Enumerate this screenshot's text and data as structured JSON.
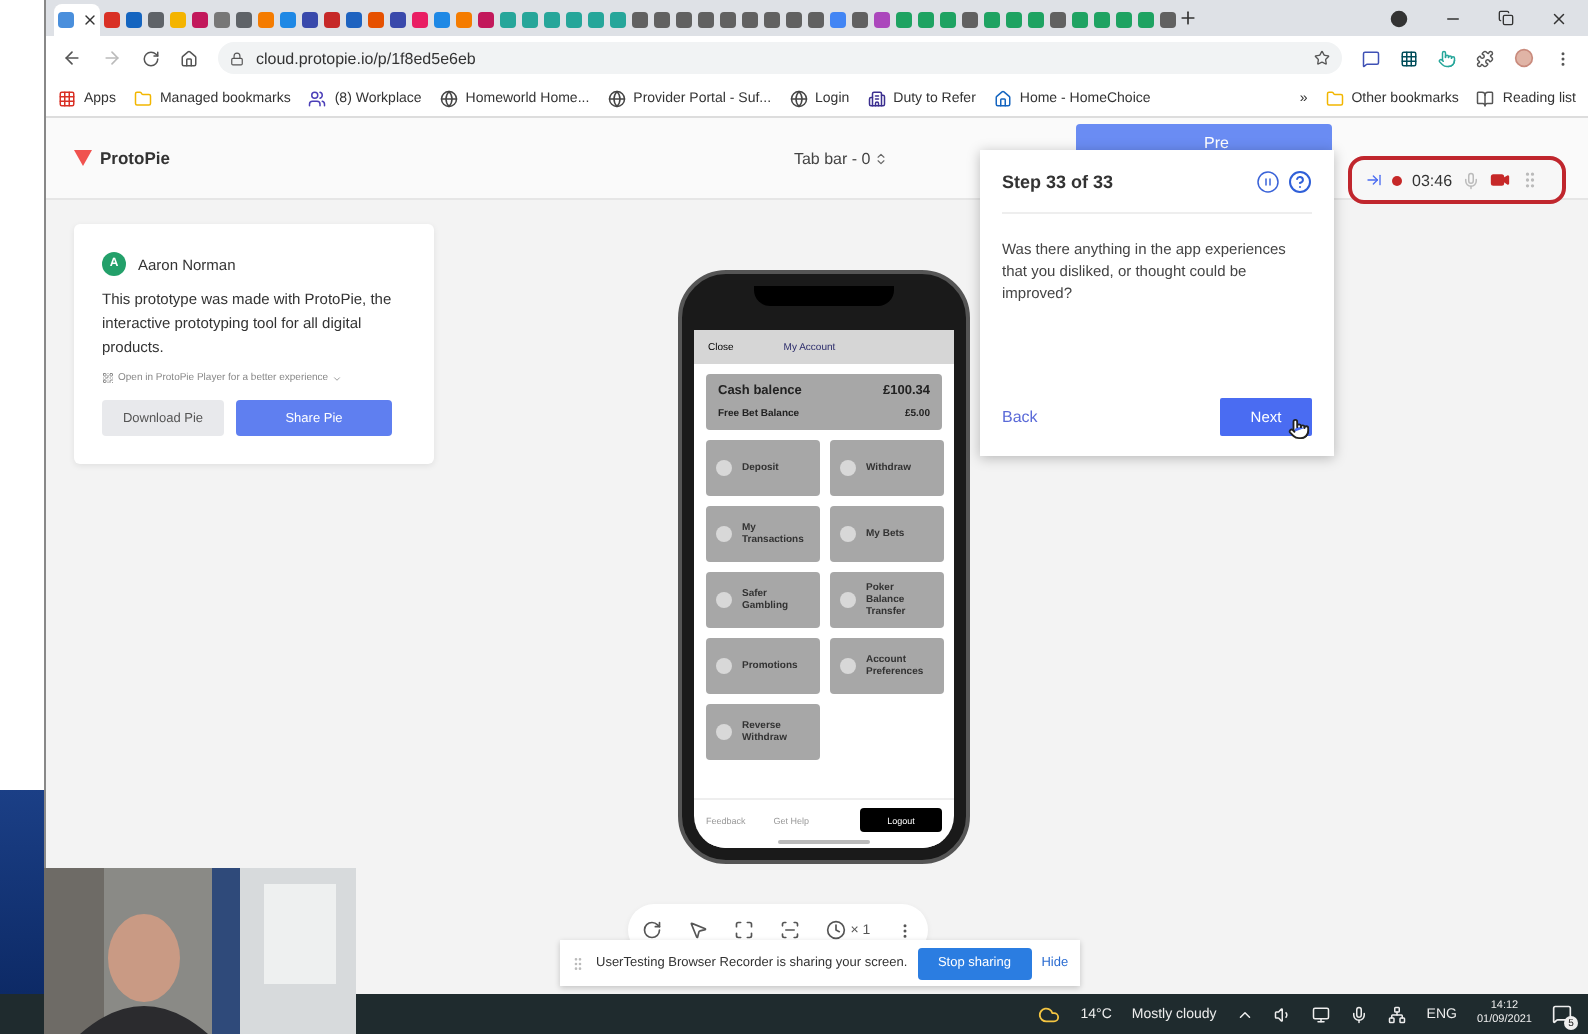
{
  "browser": {
    "tabs": [
      {
        "selected": true,
        "color": "#4a8fdc"
      },
      {
        "selected": false,
        "color": "#d93025"
      },
      {
        "selected": false,
        "color": "#1565c0"
      },
      {
        "selected": false,
        "color": "#5f6368"
      },
      {
        "selected": false,
        "color": "#f4b400"
      },
      {
        "selected": false,
        "color": "#c2185b"
      },
      {
        "selected": false,
        "color": "#777777"
      },
      {
        "selected": false,
        "color": "#5f6368"
      },
      {
        "selected": false,
        "color": "#f57c00"
      },
      {
        "selected": false,
        "color": "#1e88e5"
      },
      {
        "selected": false,
        "color": "#3949ab"
      },
      {
        "selected": false,
        "color": "#c62828"
      },
      {
        "selected": false,
        "color": "#1e63c0"
      },
      {
        "selected": false,
        "color": "#e65100"
      },
      {
        "selected": false,
        "color": "#3949ab"
      },
      {
        "selected": false,
        "color": "#e91e63"
      },
      {
        "selected": false,
        "color": "#1e88e5"
      },
      {
        "selected": false,
        "color": "#f57c00"
      },
      {
        "selected": false,
        "color": "#c2185b"
      },
      {
        "selected": false,
        "color": "#26a69a"
      },
      {
        "selected": false,
        "color": "#26a69a"
      },
      {
        "selected": false,
        "color": "#26a69a"
      },
      {
        "selected": false,
        "color": "#26a69a"
      },
      {
        "selected": false,
        "color": "#26a69a"
      },
      {
        "selected": false,
        "color": "#26a69a"
      },
      {
        "selected": false,
        "color": "#616161"
      },
      {
        "selected": false,
        "color": "#616161"
      },
      {
        "selected": false,
        "color": "#616161"
      },
      {
        "selected": false,
        "color": "#616161"
      },
      {
        "selected": false,
        "color": "#616161"
      },
      {
        "selected": false,
        "color": "#616161"
      },
      {
        "selected": false,
        "color": "#616161"
      },
      {
        "selected": false,
        "color": "#616161"
      },
      {
        "selected": false,
        "color": "#616161"
      },
      {
        "selected": false,
        "color": "#4285f4"
      },
      {
        "selected": false,
        "color": "#616161"
      },
      {
        "selected": false,
        "color": "#ab47bc"
      },
      {
        "selected": false,
        "color": "#1ea362"
      },
      {
        "selected": false,
        "color": "#1ea362"
      },
      {
        "selected": false,
        "color": "#1ea362"
      },
      {
        "selected": false,
        "color": "#616161"
      },
      {
        "selected": false,
        "color": "#1ea362"
      },
      {
        "selected": false,
        "color": "#1ea362"
      },
      {
        "selected": false,
        "color": "#1ea362"
      },
      {
        "selected": false,
        "color": "#616161"
      },
      {
        "selected": false,
        "color": "#1ea362"
      },
      {
        "selected": false,
        "color": "#1ea362"
      },
      {
        "selected": false,
        "color": "#1ea362"
      },
      {
        "selected": false,
        "color": "#1ea362"
      },
      {
        "selected": false,
        "color": "#616161"
      }
    ],
    "url": "cloud.protopie.io/p/1f8ed5e6eb",
    "bookmarks": [
      {
        "label": "Apps",
        "kind": "apps"
      },
      {
        "label": "Managed bookmarks",
        "kind": "folder"
      },
      {
        "label": "(8) Workplace",
        "kind": "workplace"
      },
      {
        "label": "Homeworld Home...",
        "kind": "globe"
      },
      {
        "label": "Provider Portal - Suf...",
        "kind": "globe"
      },
      {
        "label": "Login",
        "kind": "globe"
      },
      {
        "label": "Duty to Refer",
        "kind": "building"
      },
      {
        "label": "Home - HomeChoice",
        "kind": "house"
      }
    ],
    "more_bookmarks": "»",
    "bookmarks_right": [
      {
        "label": "Other bookmarks",
        "kind": "folder"
      },
      {
        "label": "Reading list",
        "kind": "reading"
      }
    ]
  },
  "page": {
    "logo": "ProtoPie",
    "scene": "Tab bar - 0",
    "present_button": "Pre",
    "card": {
      "avatar": "A",
      "author": "Aaron Norman",
      "description": "This prototype was made with ProtoPie, the interactive prototyping tool for all digital products.",
      "player_link": "Open in ProtoPie Player for a better experience",
      "buttons": [
        {
          "label": "Download Pie",
          "kind": "secondary"
        },
        {
          "label": "Share Pie",
          "kind": "primary"
        }
      ]
    },
    "phone": {
      "close": "Close",
      "title": "My Account",
      "balance_label": "Cash balence",
      "balance": "£100.34",
      "free_bet_label": "Free Bet Balance",
      "free_bet": "£5.00",
      "tiles": [
        "Deposit",
        "Withdraw",
        "My Transactions",
        "My Bets",
        "Safer Gambling",
        "Poker Balance Transfer",
        "Promotions",
        "Account Preferences",
        "Reverse Withdraw"
      ],
      "footer_links": [
        "Feedback",
        "Get Help"
      ],
      "logout": "Logout"
    },
    "toolbar": {
      "speed": "× 1"
    }
  },
  "task": {
    "step": "Step 33 of 33",
    "question": "Was there anything in the app experiences that you disliked, or thought could be improved?",
    "back": "Back",
    "next": "Next"
  },
  "recorder": {
    "time": "03:46",
    "recording": true,
    "mic_on": false
  },
  "share_bar": {
    "message": "UserTesting Browser Recorder is sharing your screen.",
    "stop": "Stop sharing",
    "hide": "Hide"
  },
  "taskbar": {
    "temperature": "14°C",
    "weather": "Mostly cloudy",
    "language": "ENG",
    "time": "14:12",
    "date": "01/09/2021",
    "notifications": "5"
  }
}
